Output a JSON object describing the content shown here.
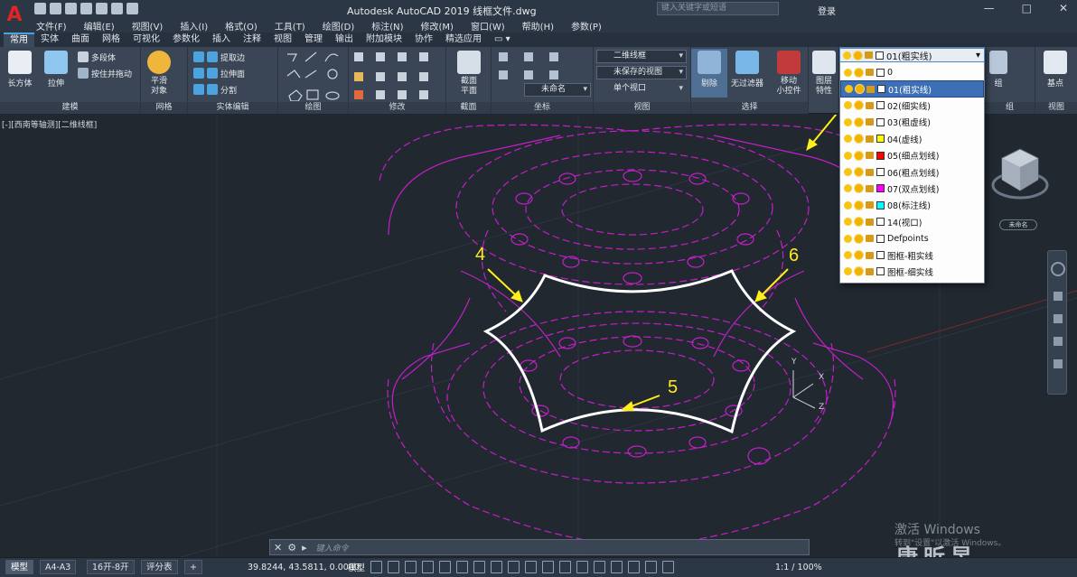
{
  "app": {
    "logo": "A",
    "title": "Autodesk AutoCAD 2019    线框文件.dwg",
    "search_placeholder": "键入关键字或短语",
    "login": "登录",
    "min": "—",
    "max": "□",
    "close": "✕"
  },
  "menu": [
    "文件(F)",
    "编辑(E)",
    "视图(V)",
    "插入(I)",
    "格式(O)",
    "工具(T)",
    "绘图(D)",
    "标注(N)",
    "修改(M)",
    "窗口(W)",
    "帮助(H)",
    "参数(P)"
  ],
  "tabs": [
    "常用",
    "实体",
    "曲面",
    "网格",
    "可视化",
    "参数化",
    "插入",
    "注释",
    "视图",
    "管理",
    "输出",
    "附加模块",
    "协作",
    "精选应用"
  ],
  "ribbon": {
    "model": {
      "box": "长方体",
      "extrude": "拉伸",
      "poly": "多段体",
      "presspull": "按住并拖动",
      "label": "建模"
    },
    "mesh": {
      "smooth": "平滑\n对象",
      "label": "网格"
    },
    "solidedit": {
      "extract": "提取边",
      "extrudeface": "拉伸面",
      "separate": "分割",
      "label": "实体编辑"
    },
    "draw": {
      "label": "绘图"
    },
    "modify": {
      "label": "修改"
    },
    "section": {
      "plane": "截面\n平面",
      "label": "截面"
    },
    "coord": {
      "ucs": "未命名",
      "label": "坐标"
    },
    "view": {
      "visual": "二维线框",
      "saved": "未保存的视图",
      "viewport": "单个视口",
      "label": "视图"
    },
    "select": {
      "cull": "剔除",
      "nofilter": "无过滤器",
      "gizmo": "移动\n小控件",
      "label": "选择"
    },
    "layers": {
      "props": "图层\n特性",
      "label": "图层"
    },
    "group": {
      "btn": "组",
      "label": "组"
    },
    "viewright": {
      "base": "基点",
      "label": "视图"
    }
  },
  "viewport_label": "[-][西南等轴测][二维线框]",
  "layer_current": "01(粗实线)",
  "layers": [
    {
      "name": "0",
      "color": "#ffffff"
    },
    {
      "name": "01(粗实线)",
      "color": "#ffffff",
      "selected": true
    },
    {
      "name": "02(细实线)",
      "color": "#ffffff"
    },
    {
      "name": "03(粗虚线)",
      "color": "#ffffff"
    },
    {
      "name": "04(虚线)",
      "color": "#ffff00"
    },
    {
      "name": "05(细点划线)",
      "color": "#ff0000"
    },
    {
      "name": "06(粗点划线)",
      "color": "#ffffff"
    },
    {
      "name": "07(双点划线)",
      "color": "#ff00ff"
    },
    {
      "name": "08(标注线)",
      "color": "#00ffff"
    },
    {
      "name": "14(视口)",
      "color": "#ffffff"
    },
    {
      "name": "Defpoints",
      "color": "#ffffff"
    },
    {
      "name": "图框-粗实线",
      "color": "#ffffff"
    },
    {
      "name": "图框-细实线",
      "color": "#ffffff"
    }
  ],
  "annotations": {
    "n4": "4",
    "n5": "5",
    "n6": "6"
  },
  "ucs": {
    "x": "X",
    "y": "Y",
    "z": "Z"
  },
  "viewcube": {
    "label": "未命名"
  },
  "cmd": {
    "placeholder": "键入命令"
  },
  "layout_tabs": [
    "模型",
    "A4-A3",
    "16开-8开",
    "评分表"
  ],
  "status": {
    "coords": "39.8244, 43.5811, 0.0000",
    "model": "模型",
    "scale": "1:1 / 100%"
  },
  "watermark": {
    "line1": "激活 Windows",
    "line2": "转到\"设置\"以激活 Windows。",
    "brand": "康昕昱"
  }
}
